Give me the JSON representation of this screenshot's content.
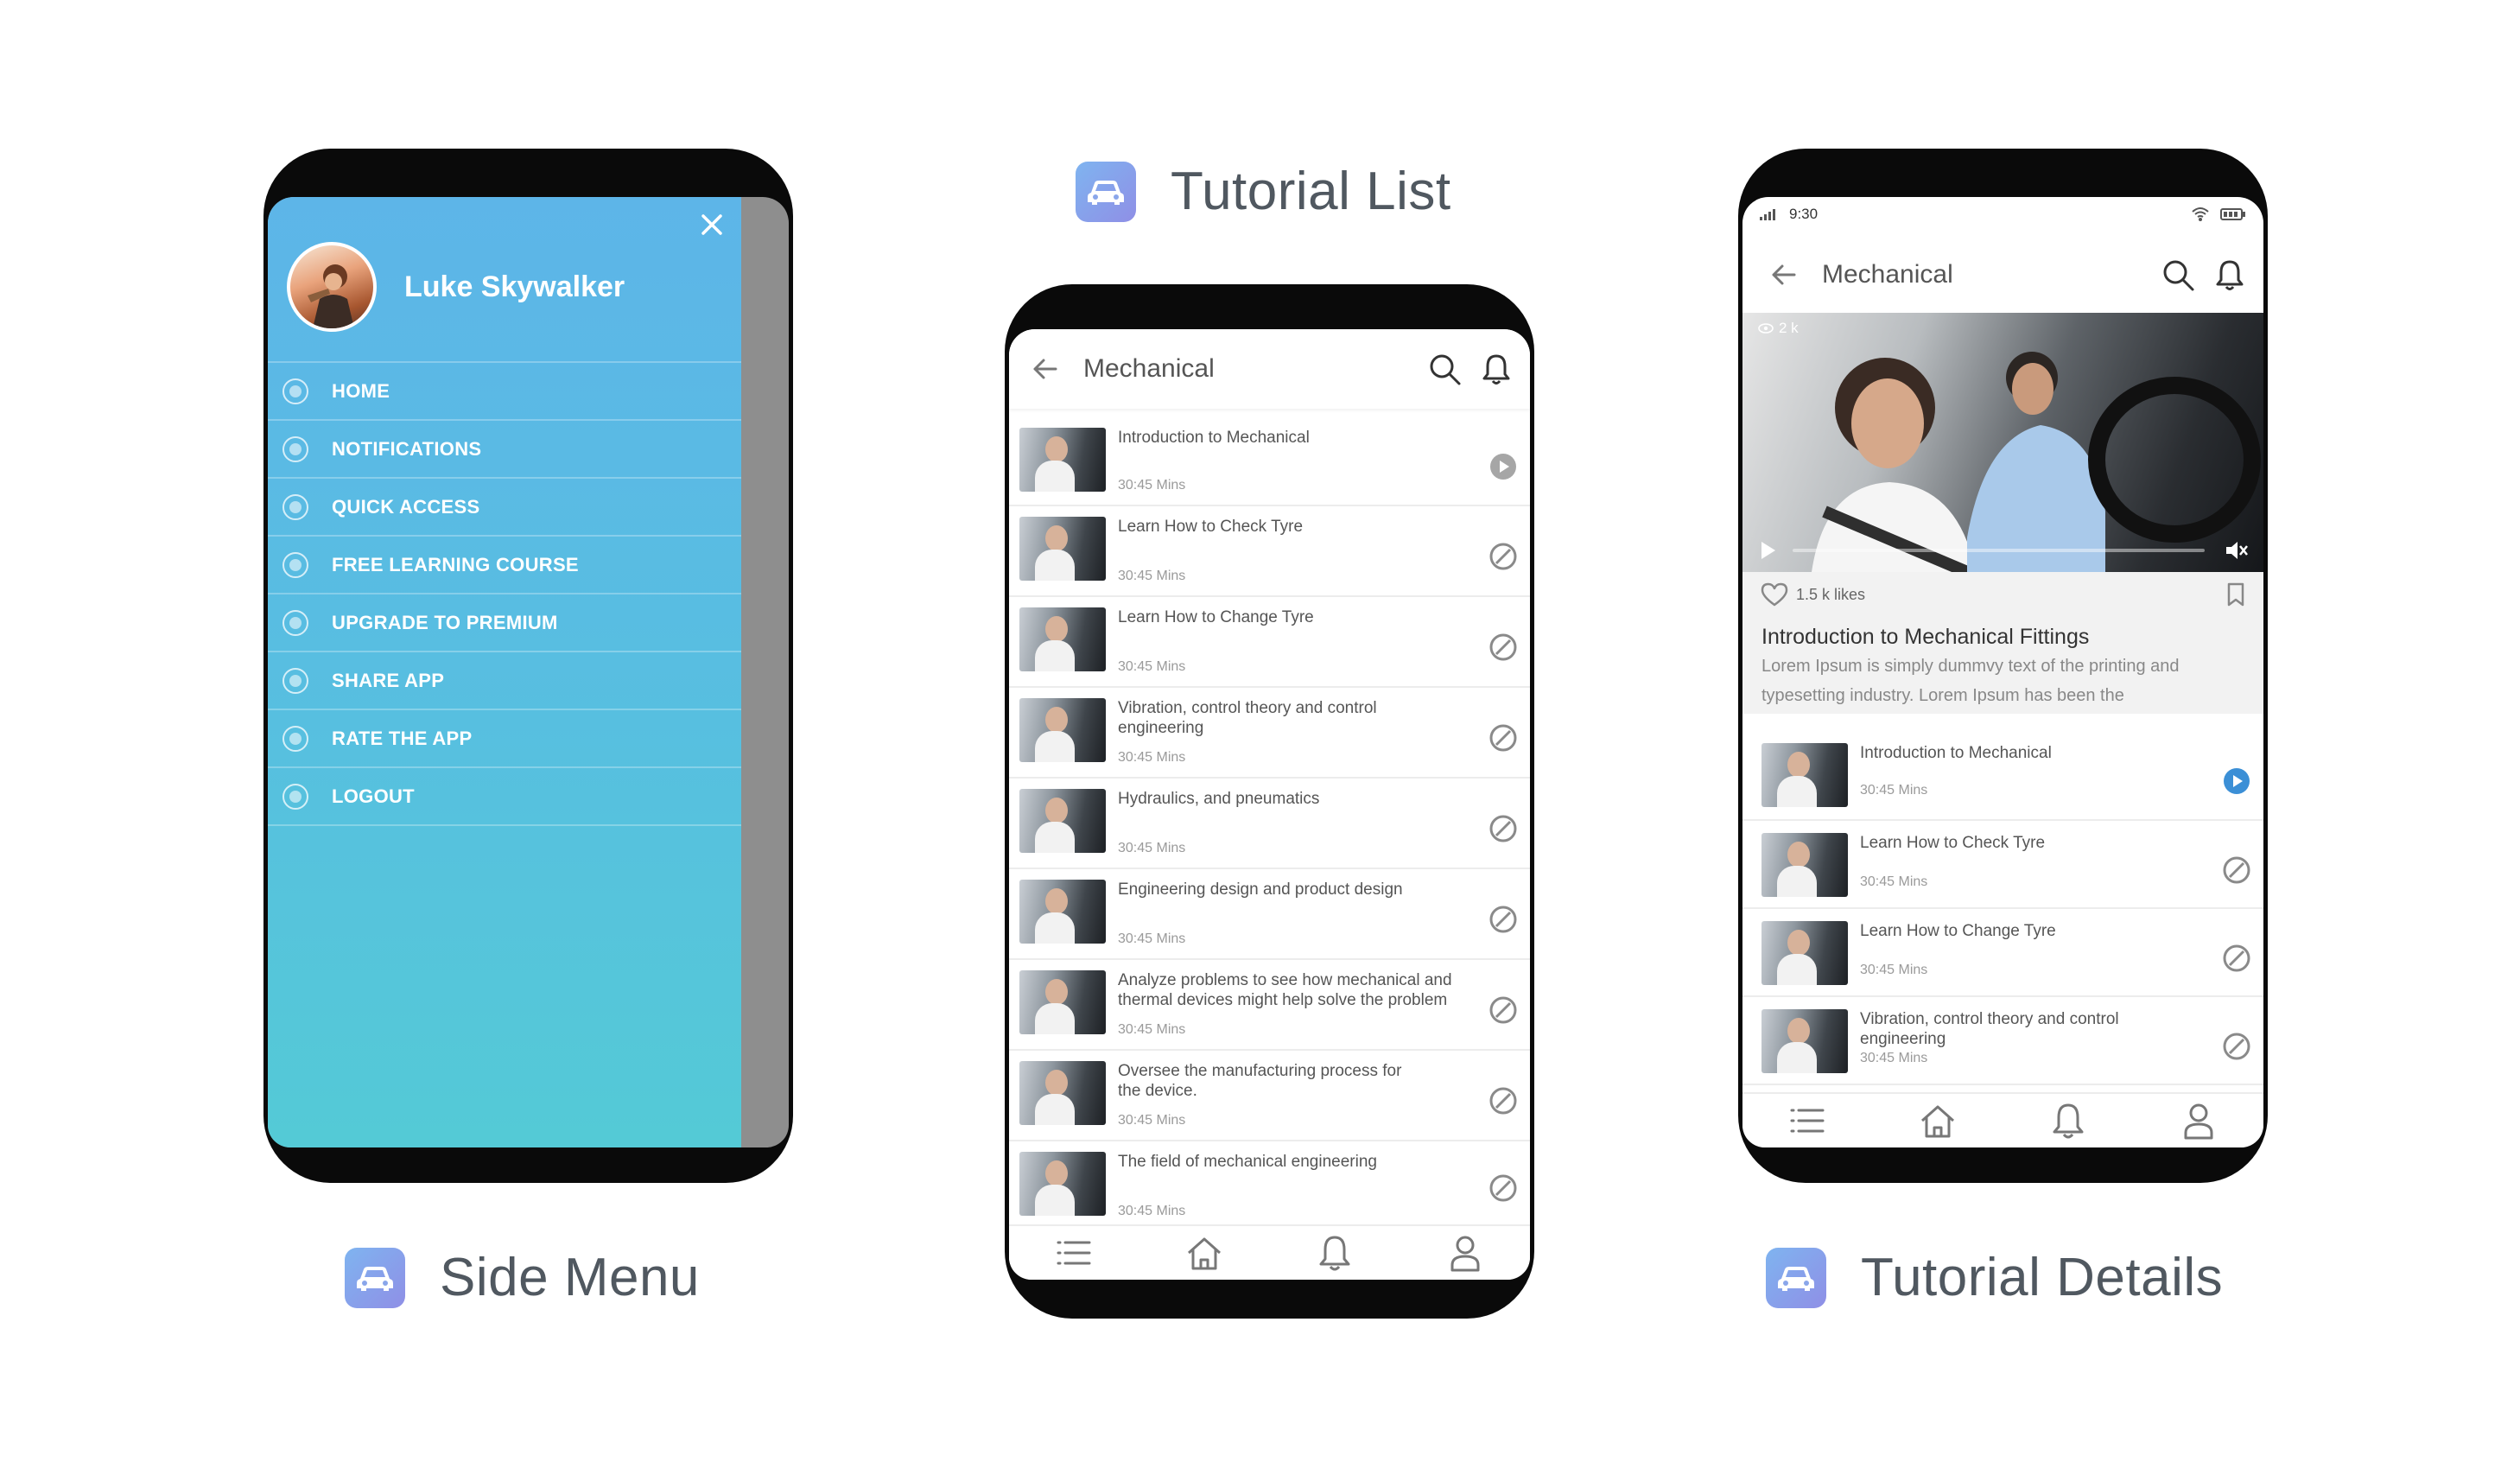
{
  "captions": {
    "tutorial_list": "Tutorial List",
    "side_menu": "Side Menu",
    "tutorial_details": "Tutorial Details"
  },
  "side_menu": {
    "user_name": "Luke Skywalker",
    "items": [
      {
        "label": "HOME",
        "icon": "menu-bullet-icon"
      },
      {
        "label": "NOTIFICATIONS",
        "icon": "menu-bullet-icon"
      },
      {
        "label": "QUICK ACCESS",
        "icon": "menu-bullet-icon"
      },
      {
        "label": "FREE LEARNING COURSE",
        "icon": "menu-bullet-icon"
      },
      {
        "label": "UPGRADE TO PREMIUM",
        "icon": "menu-bullet-icon"
      },
      {
        "label": "SHARE APP",
        "icon": "menu-bullet-icon"
      },
      {
        "label": "RATE THE APP",
        "icon": "menu-bullet-icon"
      },
      {
        "label": "LOGOUT",
        "icon": "menu-bullet-icon"
      }
    ]
  },
  "tutorial_list": {
    "title": "Mechanical",
    "items": [
      {
        "title": "Introduction to Mechanical",
        "time": "30:45 Mins",
        "status": "play"
      },
      {
        "title": "Learn How to Check Tyre",
        "time": "30:45 Mins",
        "status": "locked"
      },
      {
        "title": "Learn How to Change Tyre",
        "time": "30:45 Mins",
        "status": "locked"
      },
      {
        "title": "Vibration, control theory and control engineering",
        "time": "30:45 Mins",
        "status": "locked"
      },
      {
        "title": "Hydraulics, and pneumatics",
        "time": "30:45 Mins",
        "status": "locked"
      },
      {
        "title": "Engineering design and product design",
        "time": "30:45 Mins",
        "status": "locked"
      },
      {
        "title": "Analyze problems to see how mechanical and thermal devices might help solve the problem",
        "time": "30:45 Mins",
        "status": "locked"
      },
      {
        "title": "Oversee the manufacturing process for the device.",
        "time": "30:45 Mins",
        "status": "locked"
      },
      {
        "title": "The field of mechanical engineering",
        "time": "30:45 Mins",
        "status": "locked"
      }
    ]
  },
  "tutorial_details": {
    "status_time": "9:30",
    "title": "Mechanical",
    "view_count": "2 k",
    "likes": "1.5 k likes",
    "video_title": "Introduction to Mechanical Fittings",
    "description": "Lorem Ipsum is simply dummvy text of the printing and typesetting industry. Lorem Ipsum has been the",
    "items": [
      {
        "title": "Introduction to Mechanical",
        "time": "30:45 Mins",
        "status": "play"
      },
      {
        "title": "Learn How to Check Tyre",
        "time": "30:45 Mins",
        "status": "locked"
      },
      {
        "title": "Learn How to Change Tyre",
        "time": "30:45 Mins",
        "status": "locked"
      },
      {
        "title": "Vibration, control theory and control engineering",
        "time": "30:45 Mins",
        "status": "locked"
      }
    ]
  },
  "colors": {
    "menu_gradient_top": "#5db5e8",
    "menu_gradient_bottom": "#54cad6",
    "accent_play": "#3b8fd6",
    "app_icon_gradient": "#7fb4f0"
  }
}
